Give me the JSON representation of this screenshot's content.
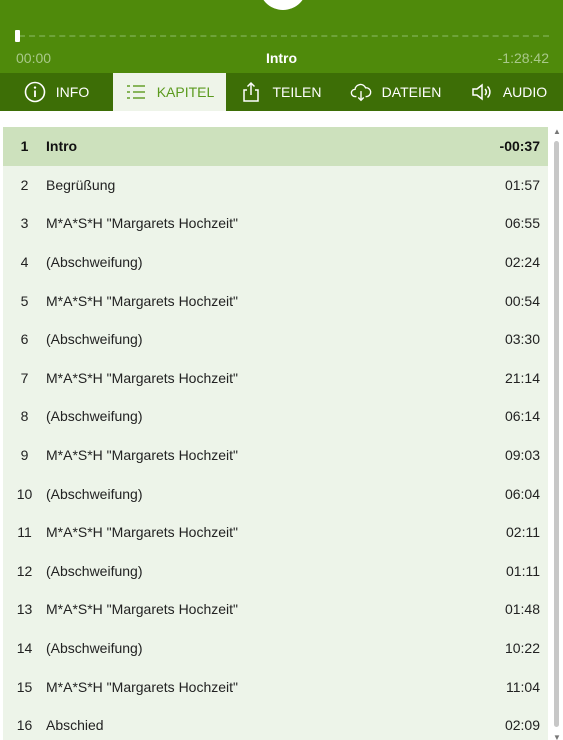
{
  "player": {
    "elapsed": "00:00",
    "title": "Intro",
    "remaining": "-1:28:42",
    "progress": 0.0
  },
  "tabs": [
    {
      "label": "INFO",
      "icon": "info-icon"
    },
    {
      "label": "KAPITEL",
      "icon": "list-icon",
      "active": true
    },
    {
      "label": "TEILEN",
      "icon": "share-icon"
    },
    {
      "label": "DATEIEN",
      "icon": "cloud-download-icon"
    },
    {
      "label": "AUDIO",
      "icon": "speaker-icon"
    }
  ],
  "chapters": [
    {
      "num": "1",
      "title": "Intro",
      "duration": "-00:37",
      "current": true
    },
    {
      "num": "2",
      "title": "Begrüßung",
      "duration": "01:57"
    },
    {
      "num": "3",
      "title": "M*A*S*H \"Margarets Hochzeit\"",
      "duration": "06:55"
    },
    {
      "num": "4",
      "title": "(Abschweifung)",
      "duration": "02:24"
    },
    {
      "num": "5",
      "title": "M*A*S*H \"Margarets Hochzeit\"",
      "duration": "00:54"
    },
    {
      "num": "6",
      "title": "(Abschweifung)",
      "duration": "03:30"
    },
    {
      "num": "7",
      "title": "M*A*S*H \"Margarets Hochzeit\"",
      "duration": "21:14"
    },
    {
      "num": "8",
      "title": "(Abschweifung)",
      "duration": "06:14"
    },
    {
      "num": "9",
      "title": "M*A*S*H \"Margarets Hochzeit\"",
      "duration": "09:03"
    },
    {
      "num": "10",
      "title": "(Abschweifung)",
      "duration": "06:04"
    },
    {
      "num": "11",
      "title": "M*A*S*H \"Margarets Hochzeit\"",
      "duration": "02:11"
    },
    {
      "num": "12",
      "title": "(Abschweifung)",
      "duration": "01:11"
    },
    {
      "num": "13",
      "title": "M*A*S*H \"Margarets Hochzeit\"",
      "duration": "01:48"
    },
    {
      "num": "14",
      "title": "(Abschweifung)",
      "duration": "10:22"
    },
    {
      "num": "15",
      "title": "M*A*S*H \"Margarets Hochzeit\"",
      "duration": "11:04"
    },
    {
      "num": "16",
      "title": "Abschied",
      "duration": "02:09"
    }
  ],
  "colors": {
    "header": "#4f8a0b",
    "tabbar": "#3d6e06",
    "active_tab_text": "#5b9a1e",
    "list_bg": "#edf4e9",
    "current_row": "#cde1bd"
  }
}
